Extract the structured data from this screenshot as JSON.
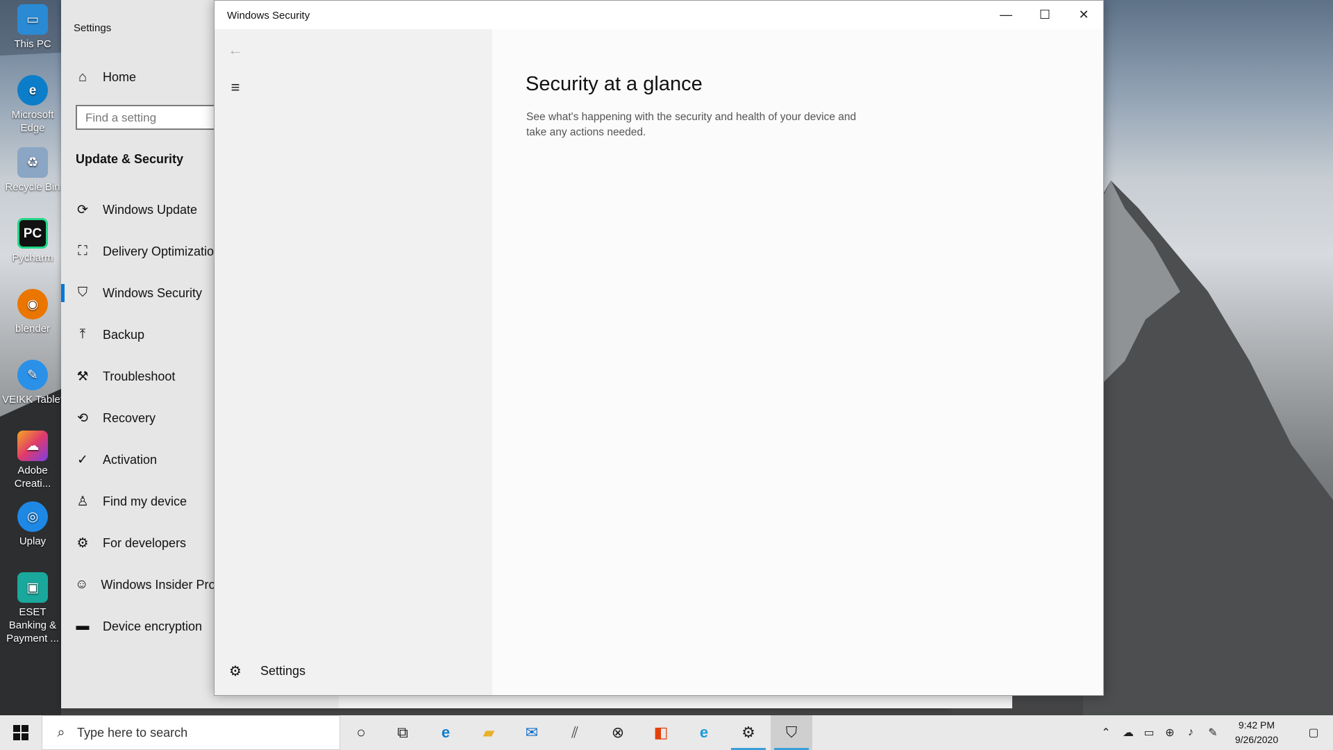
{
  "desktop": {
    "icons": [
      {
        "label": "This PC",
        "icon": "this-pc-icon",
        "color": "#2a8ad4"
      },
      {
        "label": "Microsoft Edge",
        "icon": "edge-icon",
        "color": "#0c7ec9"
      },
      {
        "label": "Recycle Bin",
        "icon": "recycle-bin-icon",
        "color": "#8aa6c4"
      },
      {
        "label": "Pycharm",
        "icon": "pycharm-icon",
        "color": "#21d789"
      },
      {
        "label": "blender",
        "icon": "blender-icon",
        "color": "#ea7600"
      },
      {
        "label": "VEIKK Tablet",
        "icon": "veikk-icon",
        "color": "#2a90e8"
      },
      {
        "label": "Adobe Creati...",
        "icon": "adobe-creative-cloud-icon",
        "color": "#e03a6b"
      },
      {
        "label": "Uplay",
        "icon": "uplay-icon",
        "color": "#1e88e5"
      },
      {
        "label": "ESET Banking & Payment ...",
        "icon": "eset-icon",
        "color": "#1aa79c"
      }
    ]
  },
  "settings": {
    "title": "Settings",
    "home_label": "Home",
    "search_placeholder": "Find a setting",
    "section_title": "Update & Security",
    "nav": [
      {
        "label": "Windows Update",
        "icon": "sync-icon",
        "active": false
      },
      {
        "label": "Delivery Optimization",
        "icon": "delivery-optimization-icon",
        "active": false
      },
      {
        "label": "Windows Security",
        "icon": "shield-icon",
        "active": true
      },
      {
        "label": "Backup",
        "icon": "backup-arrow-icon",
        "active": false
      },
      {
        "label": "Troubleshoot",
        "icon": "wrench-icon",
        "active": false
      },
      {
        "label": "Recovery",
        "icon": "recovery-icon",
        "active": false
      },
      {
        "label": "Activation",
        "icon": "check-circle-icon",
        "active": false
      },
      {
        "label": "Find my device",
        "icon": "person-pin-icon",
        "active": false
      },
      {
        "label": "For developers",
        "icon": "developer-tools-icon",
        "active": false
      },
      {
        "label": "Windows Insider Program",
        "icon": "insider-cat-icon",
        "active": false
      },
      {
        "label": "Device encryption",
        "icon": "encryption-icon",
        "active": false
      }
    ]
  },
  "security": {
    "title": "Windows Security",
    "heading": "Security at a glance",
    "description": "See what's happening with the security and health of your device and take any actions needed.",
    "settings_label": "Settings"
  },
  "taskbar": {
    "search_placeholder": "Type here to search",
    "apps": [
      {
        "icon": "cortana-icon",
        "running": false,
        "active": false
      },
      {
        "icon": "task-view-icon",
        "running": false,
        "active": false
      },
      {
        "icon": "edge-icon",
        "running": false,
        "active": false
      },
      {
        "icon": "file-explorer-icon",
        "running": false,
        "active": false
      },
      {
        "icon": "mail-icon",
        "running": false,
        "active": false
      },
      {
        "icon": "pen-app-icon",
        "running": false,
        "active": false
      },
      {
        "icon": "xbox-icon",
        "running": false,
        "active": false
      },
      {
        "icon": "office-icon",
        "running": false,
        "active": false
      },
      {
        "icon": "edge-beta-icon",
        "running": false,
        "active": false
      },
      {
        "icon": "settings-gear-icon",
        "running": true,
        "active": false
      },
      {
        "icon": "windows-security-icon",
        "running": true,
        "active": true
      }
    ],
    "time": "9:42 PM",
    "date": "9/26/2020"
  },
  "colors": {
    "accent": "#0078d7",
    "taskbar_indicator": "#3a9fd8"
  }
}
